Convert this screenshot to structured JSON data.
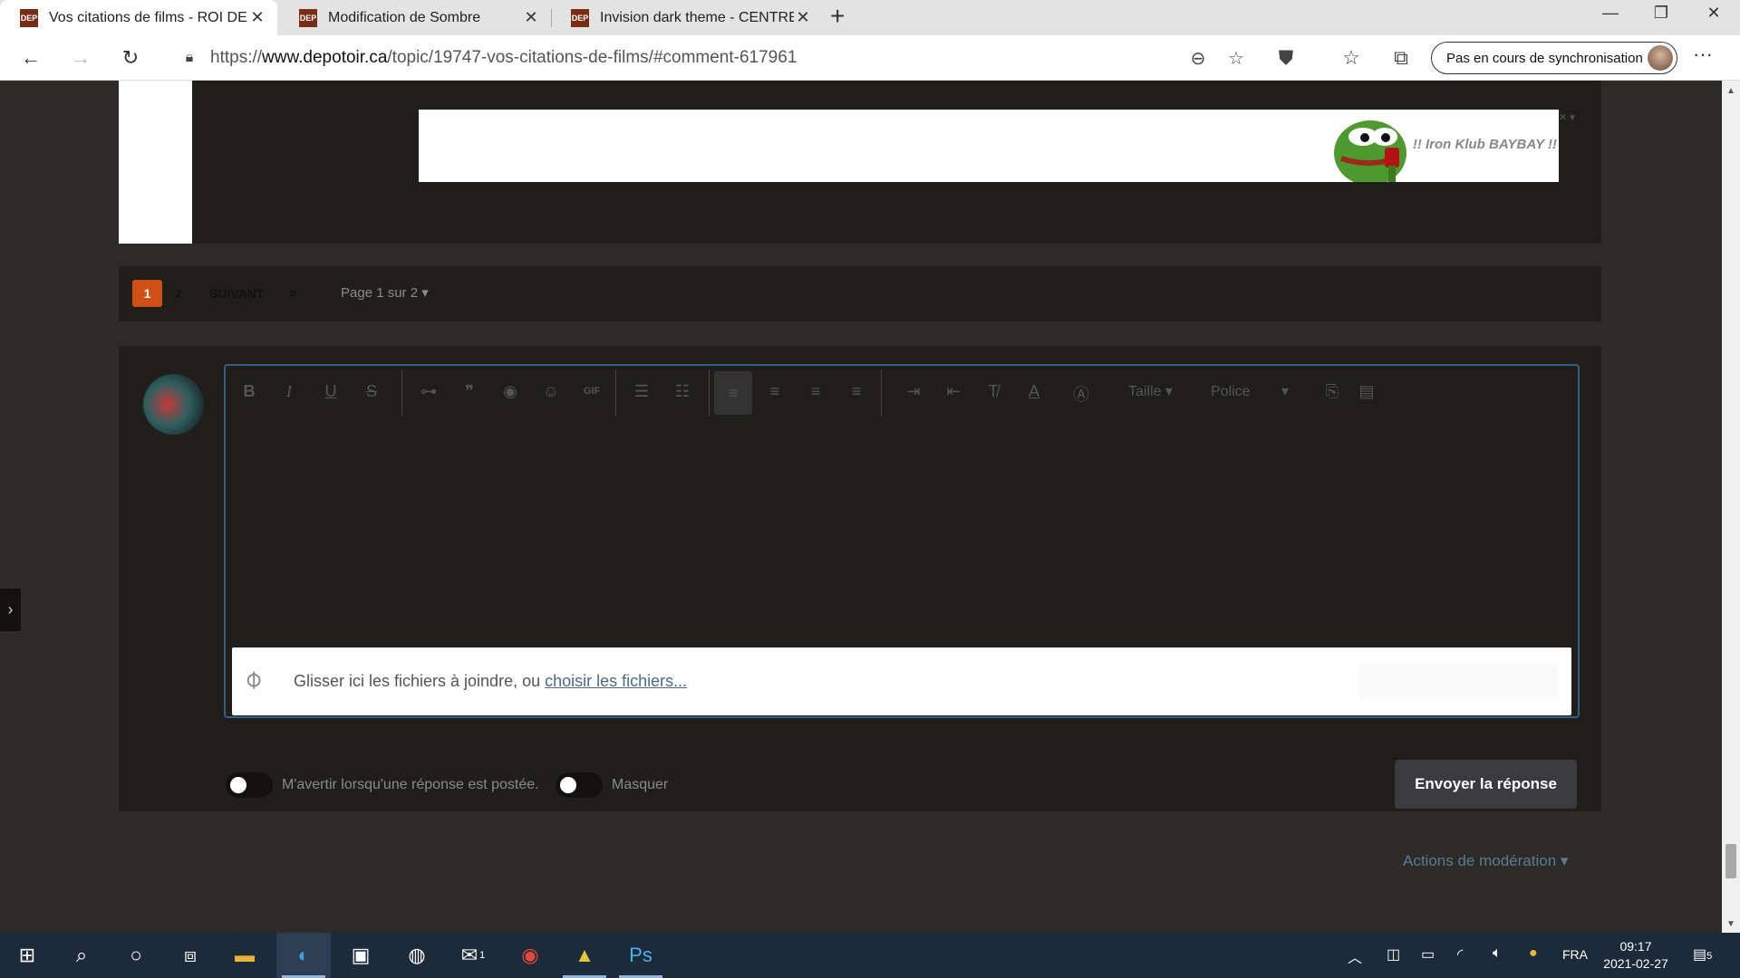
{
  "browser": {
    "tabs": [
      {
        "favicon": "DEP",
        "title": "Vos citations de films - ROI DE LA"
      },
      {
        "favicon": "DEP",
        "title": "Modification de Sombre"
      },
      {
        "favicon": "DEP",
        "title": "Invision dark theme - CENTRE DE"
      }
    ],
    "url_prefix": "https://",
    "url_domain": "www.depotoir.ca",
    "url_path": "/topic/19747-vos-citations-de-films/#comment-617961",
    "sync_label": "Pas en cours de synchronisation"
  },
  "signature": {
    "text": "!! Iron Klub BAYBAY !!"
  },
  "pagination": {
    "current": "1",
    "page2": "2",
    "next_label": "SUIVANT",
    "last_label": "»",
    "page_jump_label": "Page 1 sur 2"
  },
  "editor": {
    "toolbar": {
      "size_label": "Taille",
      "font_label": "Police"
    },
    "dropzone_text": "Glisser ici les fichiers à joindre, ou ",
    "dropzone_link": "choisir les fichiers..."
  },
  "options": {
    "notify_label": "M'avertir lorsqu'une réponse est postée.",
    "hide_label": "Masquer"
  },
  "submit_label": "Envoyer la réponse",
  "moderation_label": "Actions de modération",
  "taskbar": {
    "mail_badge": "1",
    "language": "FRA",
    "time": "09:17",
    "date": "2021-02-27",
    "notification_count": "5"
  }
}
